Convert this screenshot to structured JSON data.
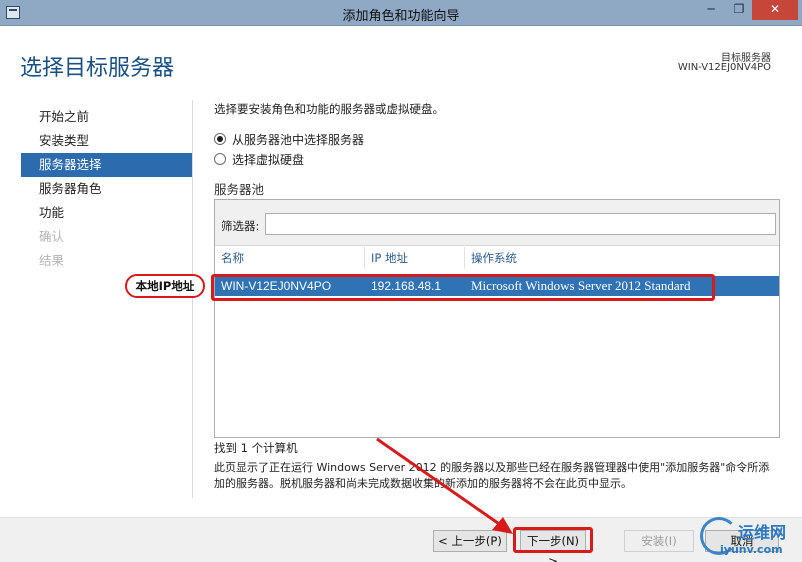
{
  "window": {
    "title": "添加角色和功能向导",
    "minimize": "─",
    "maximize": "❐",
    "close": "✕"
  },
  "header": {
    "page_title": "选择目标服务器",
    "dest_label": "目标服务器",
    "dest_value": "WIN-V12EJ0NV4PO"
  },
  "nav": {
    "items": [
      {
        "label": "开始之前",
        "state": "normal"
      },
      {
        "label": "安装类型",
        "state": "normal"
      },
      {
        "label": "服务器选择",
        "state": "active"
      },
      {
        "label": "服务器角色",
        "state": "normal"
      },
      {
        "label": "功能",
        "state": "normal"
      },
      {
        "label": "确认",
        "state": "disabled"
      },
      {
        "label": "结果",
        "state": "disabled"
      }
    ]
  },
  "main": {
    "intro": "选择要安装角色和功能的服务器或虚拟硬盘。",
    "radio_pool": "从服务器池中选择服务器",
    "radio_vhd": "选择虚拟硬盘",
    "pool_title": "服务器池",
    "filter_label": "筛选器:",
    "filter_value": "",
    "columns": {
      "name": "名称",
      "ip": "IP 地址",
      "os": "操作系统"
    },
    "rows": [
      {
        "name": "WIN-V12EJ0NV4PO",
        "ip": "192.168.48.1",
        "os": "Microsoft Windows Server 2012 Standard"
      }
    ],
    "found": "找到 1 个计算机",
    "description": "此页显示了正在运行 Windows Server 2012 的服务器以及那些已经在服务器管理器中使用\"添加服务器\"命令所添加的服务器。脱机服务器和尚未完成数据收集的新添加的服务器将不会在此页中显示。"
  },
  "annotation": {
    "callout": "本地IP地址"
  },
  "footer": {
    "prev": "< 上一步(P)",
    "next": "下一步(N) >",
    "install": "安装(I)",
    "cancel": "取消"
  },
  "watermark": {
    "text": "运维网",
    "url": "iyunv.com"
  },
  "colors": {
    "accent": "#2c6bae",
    "selection": "#2f73b5",
    "annotation_red": "#d51b1b",
    "title_blue": "#1a4f82"
  }
}
